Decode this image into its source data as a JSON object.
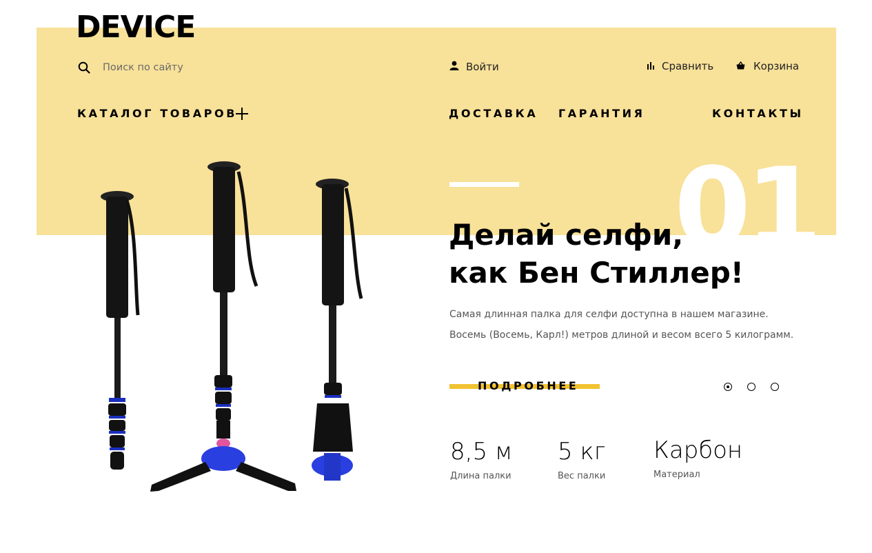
{
  "brand": {
    "logo": "DEVICE"
  },
  "colors": {
    "band": "#f8e199",
    "accent": "#f1c232",
    "text": "#000000"
  },
  "search": {
    "placeholder": "Поиск по сайту",
    "value": "",
    "icon": "search-icon"
  },
  "user_menu": {
    "login": {
      "label": "Войти",
      "icon": "user-icon"
    },
    "compare": {
      "label": "Сравнить",
      "icon": "compare-icon"
    },
    "cart": {
      "label": "Корзина",
      "icon": "basket-icon"
    }
  },
  "nav": {
    "catalog": "КАТАЛОГ ТОВАРОВ",
    "delivery": "ДОСТАВКА",
    "warranty": "ГАРАНТИЯ",
    "contacts": "КОНТАКТЫ"
  },
  "slider": {
    "number": "01",
    "title_line1": "Делай селфи,",
    "title_line2": "как Бен Стиллер!",
    "desc_line1": "Самая длинная палка для селфи доступна в нашем магазине.",
    "desc_line2": "Восемь (Восемь, Карл!) метров длиной и весом всего 5 килограмм.",
    "more": "ПОДРОБНЕЕ",
    "pagination": {
      "total": 3,
      "active": 1
    }
  },
  "features": [
    {
      "value": "8,5 м",
      "label": "Длина палки"
    },
    {
      "value": "5 кг",
      "label": "Вес палки"
    },
    {
      "value": "Карбон",
      "label": "Материал"
    }
  ]
}
